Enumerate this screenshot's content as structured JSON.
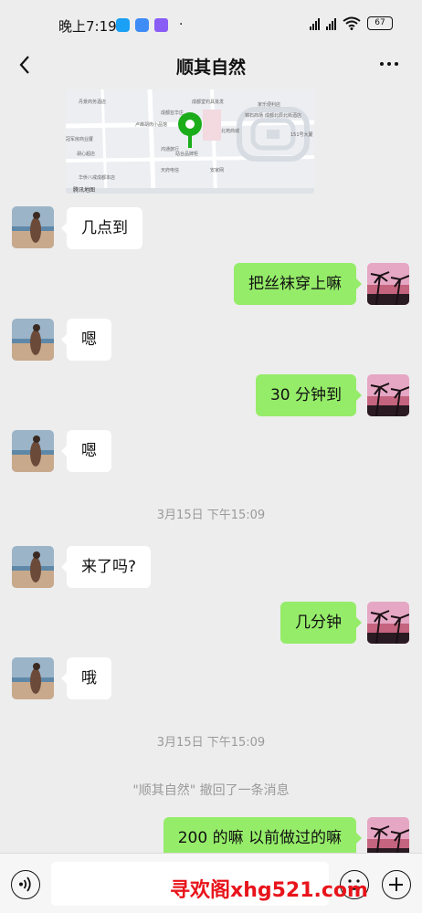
{
  "status_bar": {
    "time": "晚上7:19",
    "more": "·",
    "battery": "67"
  },
  "header": {
    "title": "顺其自然",
    "back_icon": "chevron-left-icon",
    "more_icon": "more-dots-icon"
  },
  "map": {
    "pin_color": "#1aad19",
    "labels": [
      "丹景商务酒店",
      "成都堂钓具批发",
      "家乐便利店",
      "成都亚华庄",
      "锦石商场",
      "成都北辰北街酒店",
      "卢峰胡肉小品馆",
      "北苑商城",
      "151号大厦",
      "冠军房商业厦",
      "胡心超店",
      "鸿通旅行",
      "站台品牌柜",
      "天府电信",
      "安家网",
      "华侨八戒成都本店",
      "腾讯地图"
    ]
  },
  "messages": [
    {
      "side": "in",
      "text": "几点到"
    },
    {
      "side": "out",
      "text": "把丝袜穿上嘛"
    },
    {
      "side": "in",
      "text": "嗯"
    },
    {
      "side": "out",
      "text": "30 分钟到"
    },
    {
      "side": "in",
      "text": "嗯"
    },
    {
      "side": "timestamp",
      "text": "3月15日 下午15:09"
    },
    {
      "side": "in",
      "text": "来了吗?"
    },
    {
      "side": "out",
      "text": "几分钟"
    },
    {
      "side": "in",
      "text": "哦"
    },
    {
      "side": "timestamp",
      "text": "3月15日 下午15:09"
    },
    {
      "side": "recall",
      "text": "\"顺其自然\" 撤回了一条消息"
    },
    {
      "side": "out",
      "text": "200 的嘛 以前做过的嘛"
    }
  ],
  "input_bar": {
    "voice_icon": "voice-icon",
    "emoji_icon": "emoji-icon",
    "plus_icon": "plus-icon",
    "input_value": ""
  },
  "watermark": "寻欢阁xhg521.com",
  "colors": {
    "background": "#ededed",
    "outgoing_bubble": "#95ec69",
    "incoming_bubble": "#ffffff",
    "watermark": "#e8141b"
  }
}
